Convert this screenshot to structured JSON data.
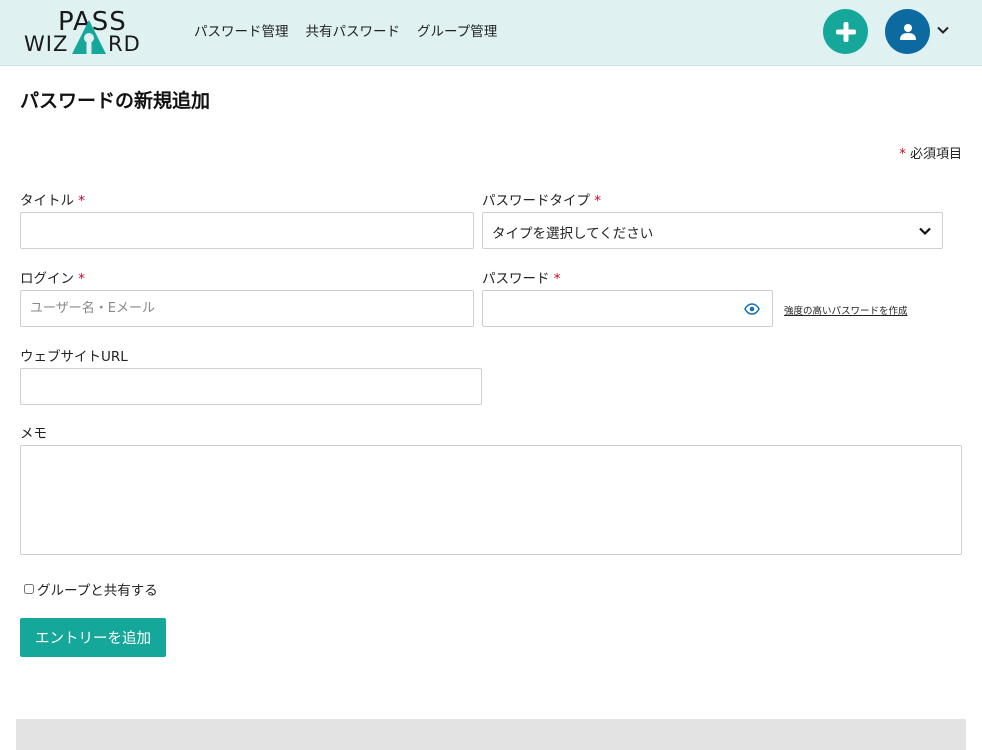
{
  "logo": {
    "line1": "PASS",
    "line2a": "WIZ",
    "line2b": "RD"
  },
  "nav": [
    {
      "label": "パスワード管理"
    },
    {
      "label": "共有パスワード"
    },
    {
      "label": "グループ管理"
    }
  ],
  "header": {
    "add_icon": "plus-icon",
    "avatar_icon": "user-icon",
    "menu_icon": "chevron-down-icon"
  },
  "page": {
    "title": "パスワードの新規追加"
  },
  "required_note": {
    "mark": "*",
    "text": "必須項目"
  },
  "form": {
    "title": {
      "label": "タイトル",
      "mark": "*",
      "value": ""
    },
    "password_type": {
      "label": "パスワードタイプ",
      "mark": "*",
      "selected": "タイプを選択してください"
    },
    "login": {
      "label": "ログイン",
      "mark": "*",
      "placeholder": "ユーザー名・Eメール"
    },
    "password": {
      "label": "パスワード",
      "mark": "*",
      "value": ""
    },
    "generate_link": "強度の高いパスワードを作成",
    "website": {
      "label": "ウェブサイトURL",
      "value": ""
    },
    "memo": {
      "label": "メモ",
      "value": ""
    },
    "share": {
      "label": "グループと共有する",
      "checked": false
    },
    "submit_label": "エントリーを追加"
  },
  "colors": {
    "accent": "#16a79b",
    "avatar": "#0d6aa0",
    "header_bg": "#dff1f1",
    "required": "#d0021b"
  }
}
